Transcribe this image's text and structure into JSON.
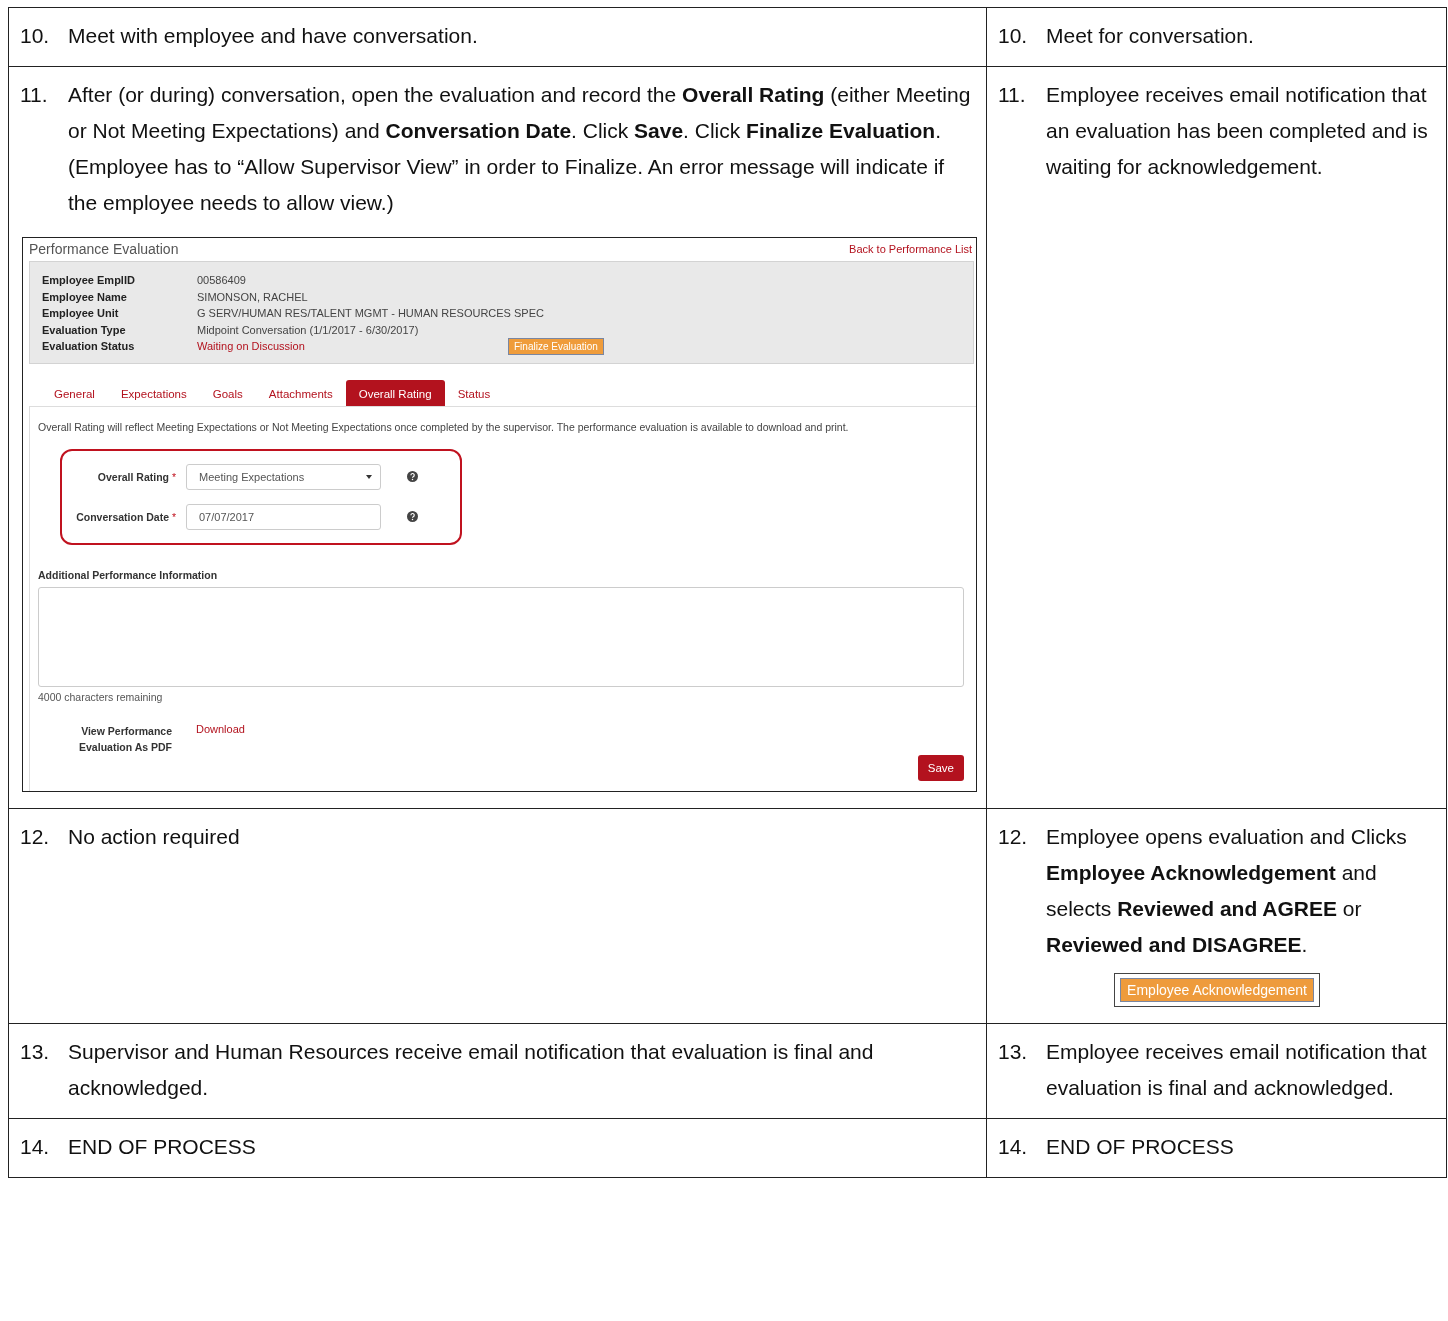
{
  "rows": [
    {
      "cells": [
        {
          "number": "10.",
          "text": "Meet with employee and have conversation."
        },
        {
          "number": "10.",
          "text": "Meet for conversation."
        }
      ]
    },
    {
      "cells": [
        {
          "number": "11.",
          "text": "After (or during) conversation, open the evaluation and record the **Overall Rating** (either Meeting or Not Meeting Expectations) and **Conversation Date**. Click **Save**. Click **Finalize Evaluation**. (Employee has to “Allow Supervisor View” in order to Finalize. An error message will indicate if the employee needs to allow view.)",
          "screenshot": {
            "title": "Performance Evaluation",
            "back_link": "Back to Performance List",
            "fields": [
              {
                "label": "Employee EmplID",
                "value": "00586409",
                "kind": "plain"
              },
              {
                "label": "Employee Name",
                "value": "SIMONSON, RACHEL",
                "kind": "plain"
              },
              {
                "label": "Employee Unit",
                "value": "G SERV/HUMAN RES/TALENT MGMT - HUMAN RESOURCES SPEC",
                "kind": "plain"
              },
              {
                "label": "Evaluation Type",
                "value": "Midpoint Conversation (1/1/2017 - 6/30/2017)",
                "kind": "plain"
              },
              {
                "label": "Evaluation Status",
                "value": "Waiting on Discussion",
                "kind": "status"
              }
            ],
            "finalize_button": "Finalize Evaluation",
            "tabs": [
              {
                "label": "General",
                "selected": false
              },
              {
                "label": "Expectations",
                "selected": false
              },
              {
                "label": "Goals",
                "selected": false
              },
              {
                "label": "Attachments",
                "selected": false
              },
              {
                "label": "Overall Rating",
                "selected": true
              },
              {
                "label": "Status",
                "selected": false
              }
            ],
            "intro": "Overall Rating will reflect Meeting Expectations or Not Meeting Expectations once completed by the supervisor. The performance evaluation is available to download and print.",
            "form": [
              {
                "label": "Overall Rating",
                "mark": "*",
                "kind": "select",
                "value": "Meeting Expectations"
              },
              {
                "label": "Conversation Date",
                "mark": "*",
                "kind": "text",
                "value": "07/07/2017"
              }
            ],
            "additional_label": "Additional Performance Information",
            "remaining": "4000 characters remaining",
            "pdf_label": "View Performance Evaluation As PDF",
            "download": "Download",
            "save": "Save"
          }
        },
        {
          "number": "11.",
          "text": "Employee receives email notification that an evaluation has been completed and is waiting for acknowledgement."
        }
      ]
    },
    {
      "cells": [
        {
          "number": "12.",
          "text": "No action required"
        },
        {
          "number": "12.",
          "text": "Employee opens evaluation and Clicks **Employee Acknowledgement** and selects **Reviewed and AGREE** or **Reviewed and DISAGREE**.",
          "button": "Employee Acknowledgement"
        }
      ]
    },
    {
      "cells": [
        {
          "number": "13.",
          "text": "Supervisor and Human Resources receive email notification that evaluation is final and acknowledged."
        },
        {
          "number": "13.",
          "text": "Employee receives email notification that evaluation is final and acknowledged."
        }
      ]
    },
    {
      "cells": [
        {
          "number": "14.",
          "text": "END OF PROCESS"
        },
        {
          "number": "14.",
          "text": "END OF PROCESS"
        }
      ]
    }
  ]
}
